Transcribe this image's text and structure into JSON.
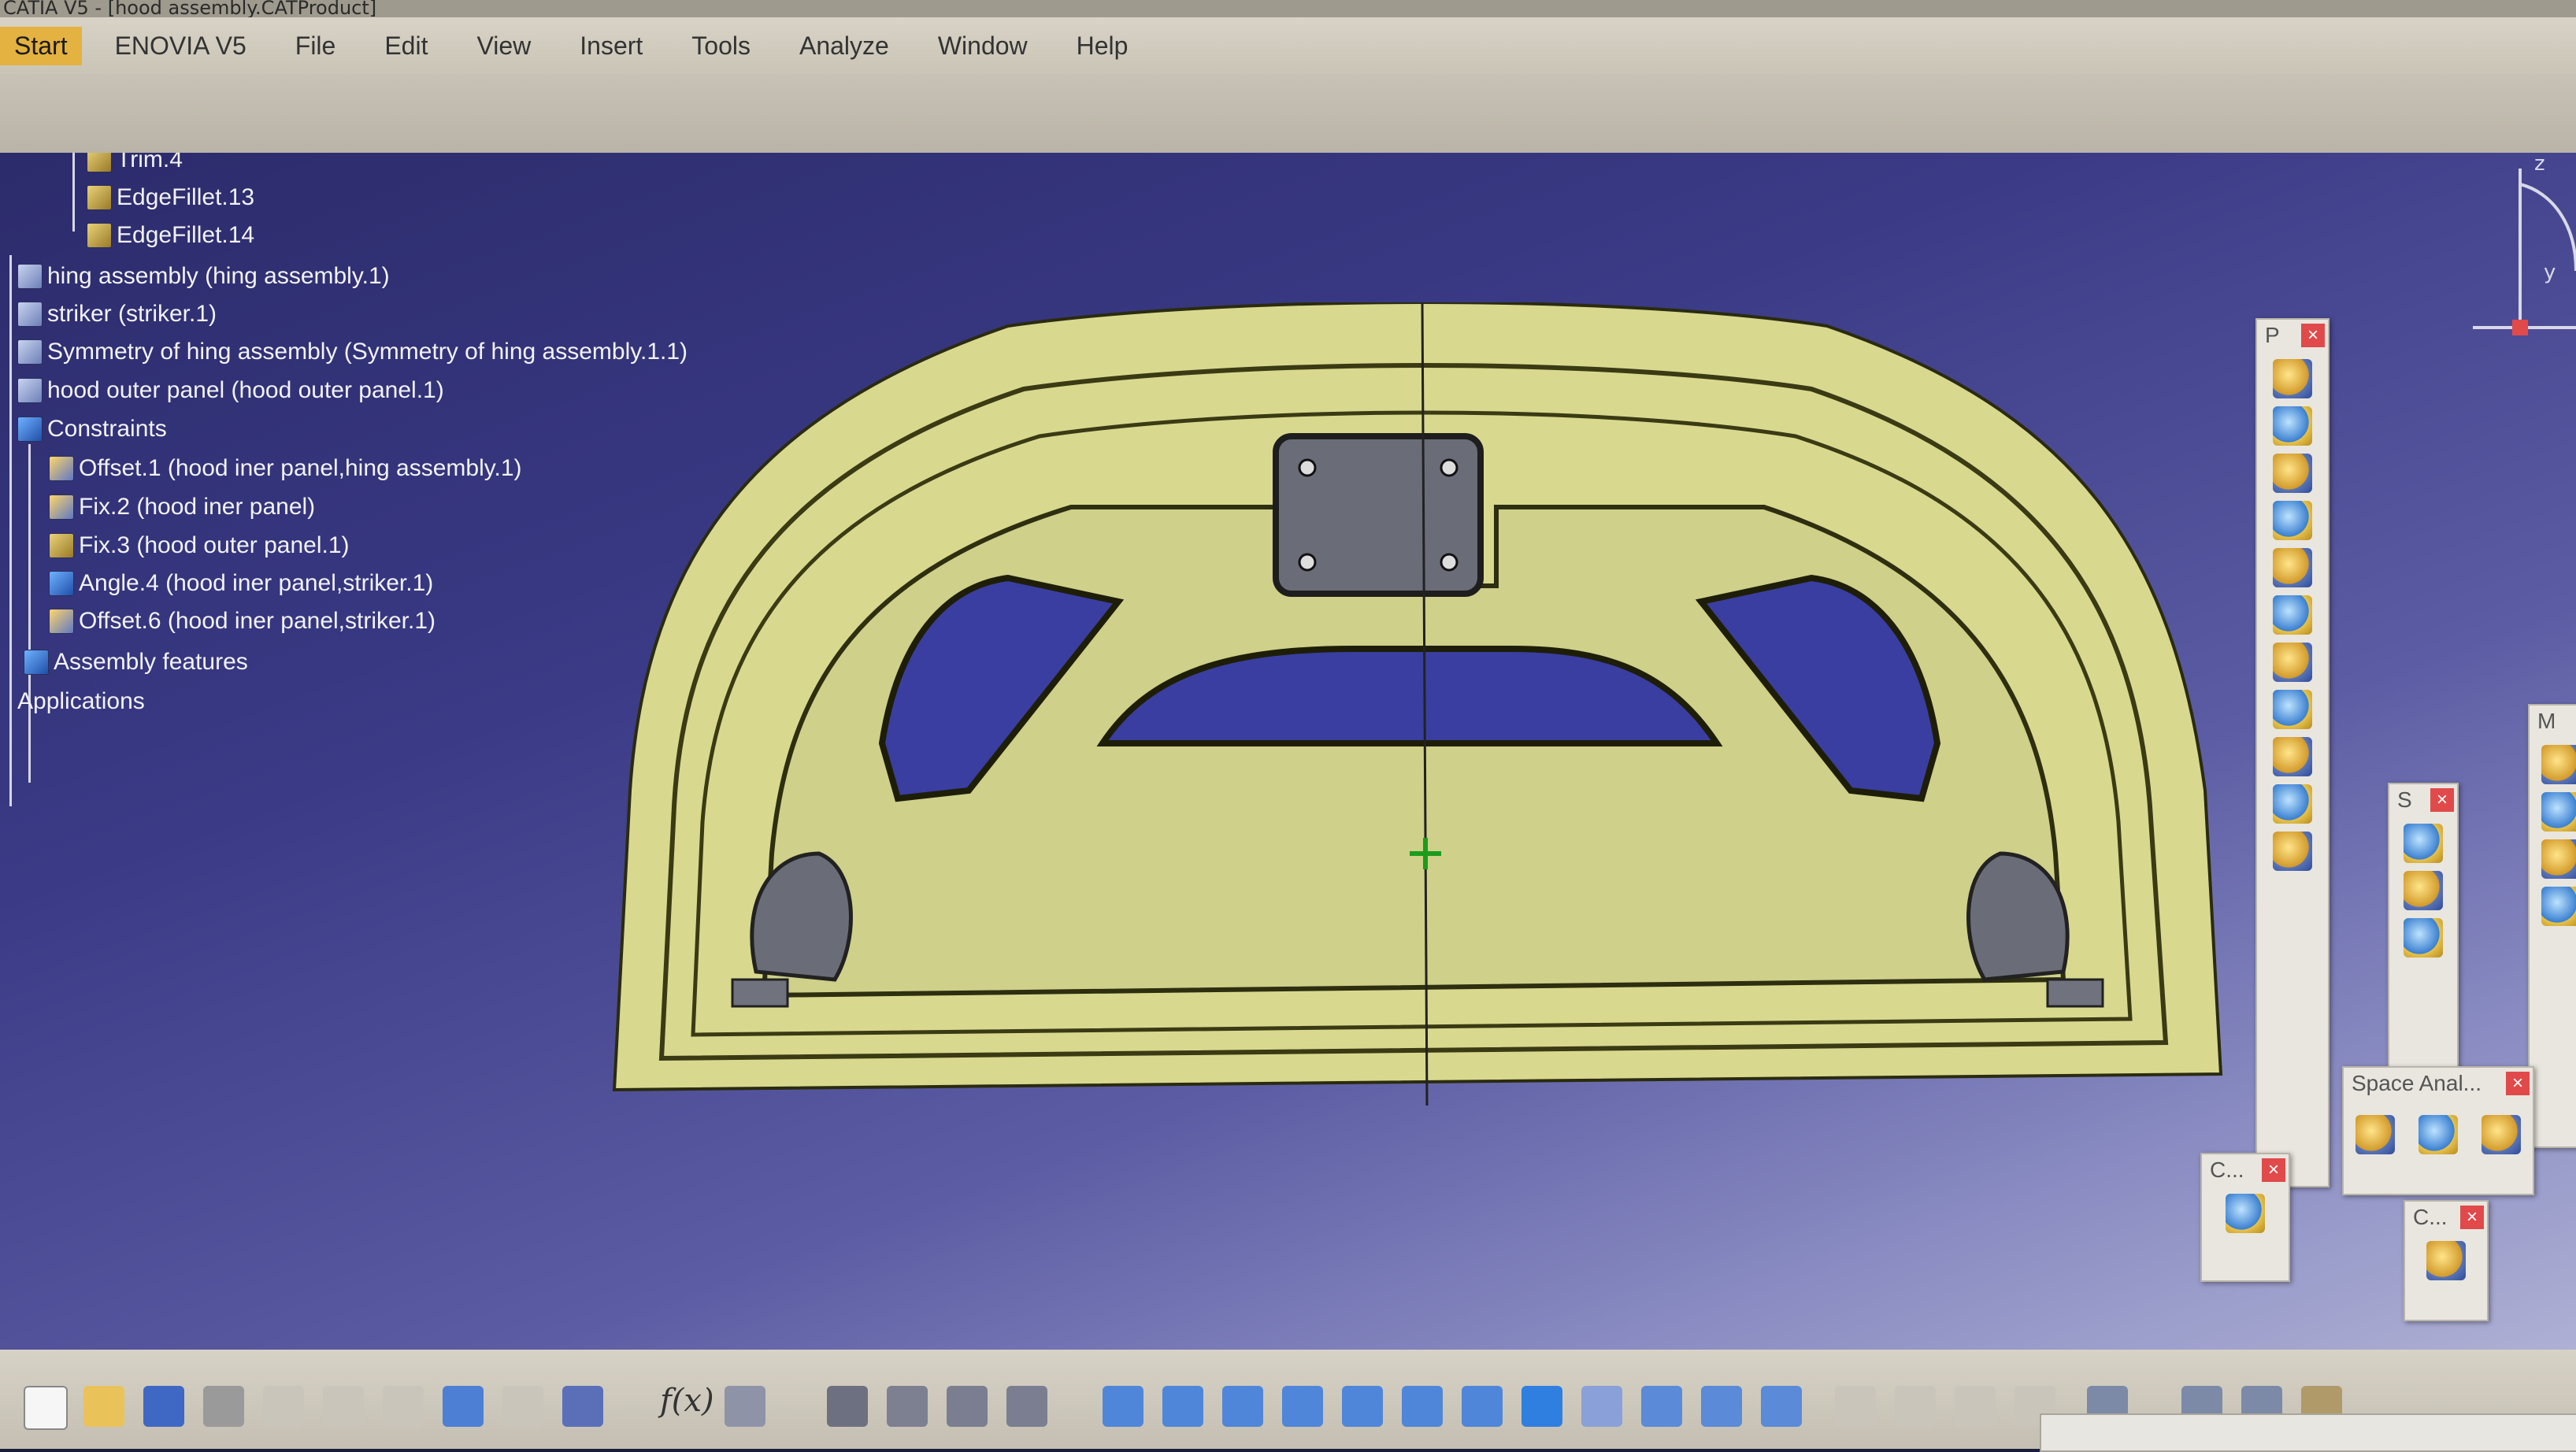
{
  "window": {
    "title": "CATIA V5 - [hood assembly.CATProduct]"
  },
  "menu": {
    "items": [
      "Start",
      "ENOVIA V5",
      "File",
      "Edit",
      "View",
      "Insert",
      "Tools",
      "Analyze",
      "Window",
      "Help"
    ]
  },
  "tree": {
    "nodes": [
      "Trim.4",
      "EdgeFillet.13",
      "EdgeFillet.14",
      "hing assembly (hing assembly.1)",
      "striker (striker.1)",
      "Symmetry of hing assembly (Symmetry of hing assembly.1.1)",
      "hood outer panel (hood outer panel.1)",
      "Constraints",
      "Offset.1 (hood iner panel,hing assembly.1)",
      "Fix.2 (hood iner panel)",
      "Fix.3 (hood outer panel.1)",
      "Angle.4 (hood iner panel,striker.1)",
      "Offset.6 (hood iner panel,striker.1)",
      "Assembly features",
      "Applications"
    ]
  },
  "compass": {
    "z_label": "z",
    "y_label": "y"
  },
  "panels": {
    "p_title": "P",
    "m_title": "M",
    "s_title": "S",
    "space_title": "Space Anal...",
    "c1_title": "C...",
    "c2_title": "C...",
    "close_glyph": "×"
  },
  "bottom_toolbar": {
    "formula_label": "f(x)"
  },
  "colors": {
    "viewport_top": "#2c2b6b",
    "viewport_bottom": "#aeb0d4",
    "part_fill": "#d8d98e",
    "menu_bg": "#d8d3c6",
    "start_highlight": "#e4b240",
    "close_red": "#e04a4a"
  }
}
